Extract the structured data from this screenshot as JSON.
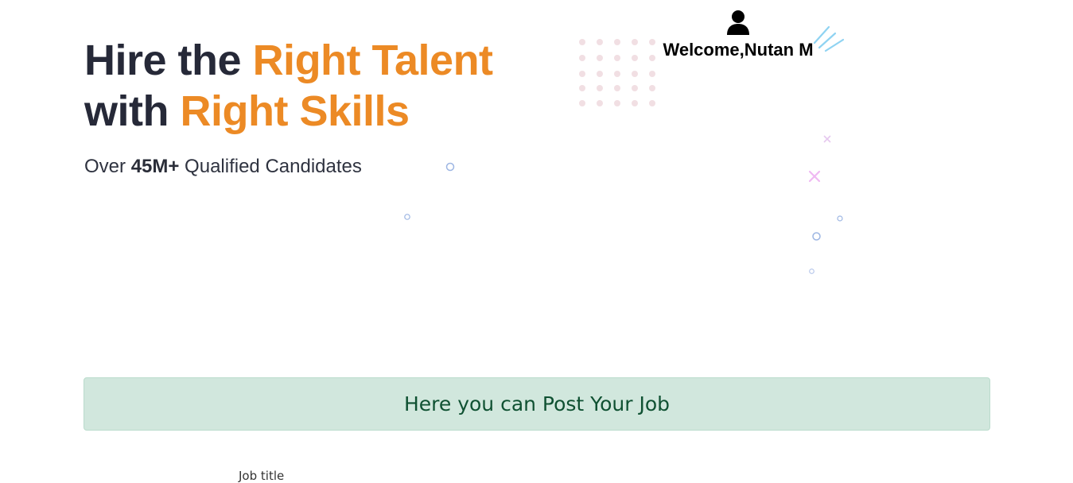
{
  "hero": {
    "title_line1_plain": "Hire the ",
    "title_line1_accent": "Right Talent",
    "title_line2_plain": "with ",
    "title_line2_accent": "Right Skills",
    "subtitle_prefix": "Over ",
    "subtitle_count": "45M+",
    "subtitle_suffix": " Qualified Candidates"
  },
  "user": {
    "icon": "user-icon",
    "welcome_text": "Welcome,Nutan M"
  },
  "banner": {
    "text": "Here you can Post Your Job"
  },
  "form": {
    "job_title_label": "Job title"
  },
  "colors": {
    "accent": "#ec8a25",
    "heading": "#262938",
    "banner_bg": "#d1e7dd",
    "banner_text": "#0f5132"
  }
}
